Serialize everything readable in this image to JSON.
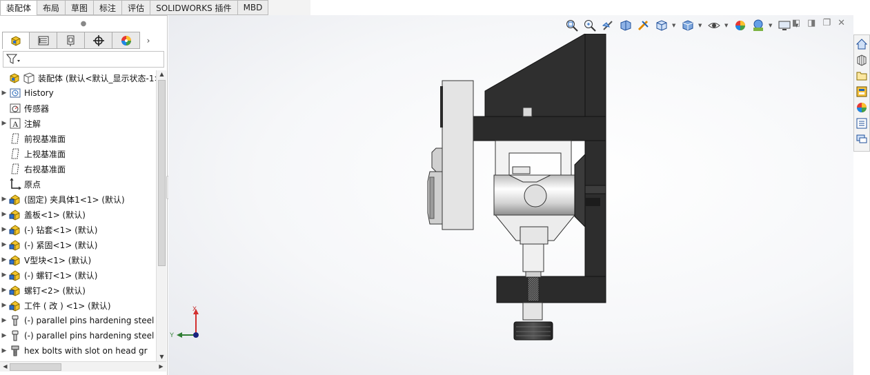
{
  "tabs": [
    "装配体",
    "布局",
    "草图",
    "标注",
    "评估",
    "SOLIDWORKS 插件",
    "MBD"
  ],
  "active_tab": "装配体",
  "panel_tabs": [
    "feature-manager",
    "property-manager",
    "configuration-manager",
    "dimxpert-manager",
    "display-manager"
  ],
  "tree": {
    "root": "装配体  (默认<默认_显示状态-1>",
    "items": [
      {
        "label": "History",
        "icon": "history-icon",
        "expandable": true
      },
      {
        "label": "传感器",
        "icon": "sensor-icon",
        "expandable": false
      },
      {
        "label": "注解",
        "icon": "annotation-icon",
        "expandable": true
      },
      {
        "label": "前视基准面",
        "icon": "plane-icon",
        "expandable": false
      },
      {
        "label": "上视基准面",
        "icon": "plane-icon",
        "expandable": false
      },
      {
        "label": "右视基准面",
        "icon": "plane-icon",
        "expandable": false
      },
      {
        "label": "原点",
        "icon": "origin-icon",
        "expandable": false
      },
      {
        "label": "(固定) 夹具体1<1> (默认)",
        "icon": "part-icon",
        "expandable": true
      },
      {
        "label": "盖板<1> (默认)",
        "icon": "part-icon",
        "expandable": true
      },
      {
        "label": "(-) 钻套<1> (默认)",
        "icon": "part-icon",
        "expandable": true
      },
      {
        "label": "(-) 紧固<1> (默认)",
        "icon": "part-icon",
        "expandable": true
      },
      {
        "label": "V型块<1> (默认)",
        "icon": "part-icon",
        "expandable": true
      },
      {
        "label": "(-) 螺钉<1> (默认)",
        "icon": "part-icon",
        "expandable": true
      },
      {
        "label": "螺钉<2> (默认)",
        "icon": "part-icon",
        "expandable": true
      },
      {
        "label": "工件 ( 改 ) <1> (默认)",
        "icon": "part-icon",
        "expandable": true
      },
      {
        "label": "(-) parallel pins hardening steel",
        "icon": "pin-icon",
        "expandable": true
      },
      {
        "label": "(-) parallel pins hardening steel",
        "icon": "pin-icon",
        "expandable": true
      },
      {
        "label": "hex bolts with slot on head gr",
        "icon": "bolt-icon",
        "expandable": true
      }
    ]
  },
  "triad": {
    "x_label": "X",
    "y_label": "Y"
  },
  "headsup_icons": [
    "zoom-to-fit-icon",
    "zoom-area-icon",
    "previous-view-icon",
    "section-view-icon",
    "dynamic-annotation-icon",
    "view-orientation-icon",
    "display-style-icon",
    "hide-show-icon",
    "edit-appearance-icon",
    "apply-scene-icon",
    "view-settings-icon"
  ],
  "taskpane_icons": [
    "home-icon",
    "design-library-icon",
    "file-explorer-icon",
    "view-palette-icon",
    "appearances-icon",
    "custom-properties-icon",
    "forum-icon"
  ],
  "colors": {
    "accent": "#1f63b8",
    "model_dark": "#2b2b2b",
    "model_light": "#e4e4e4"
  }
}
